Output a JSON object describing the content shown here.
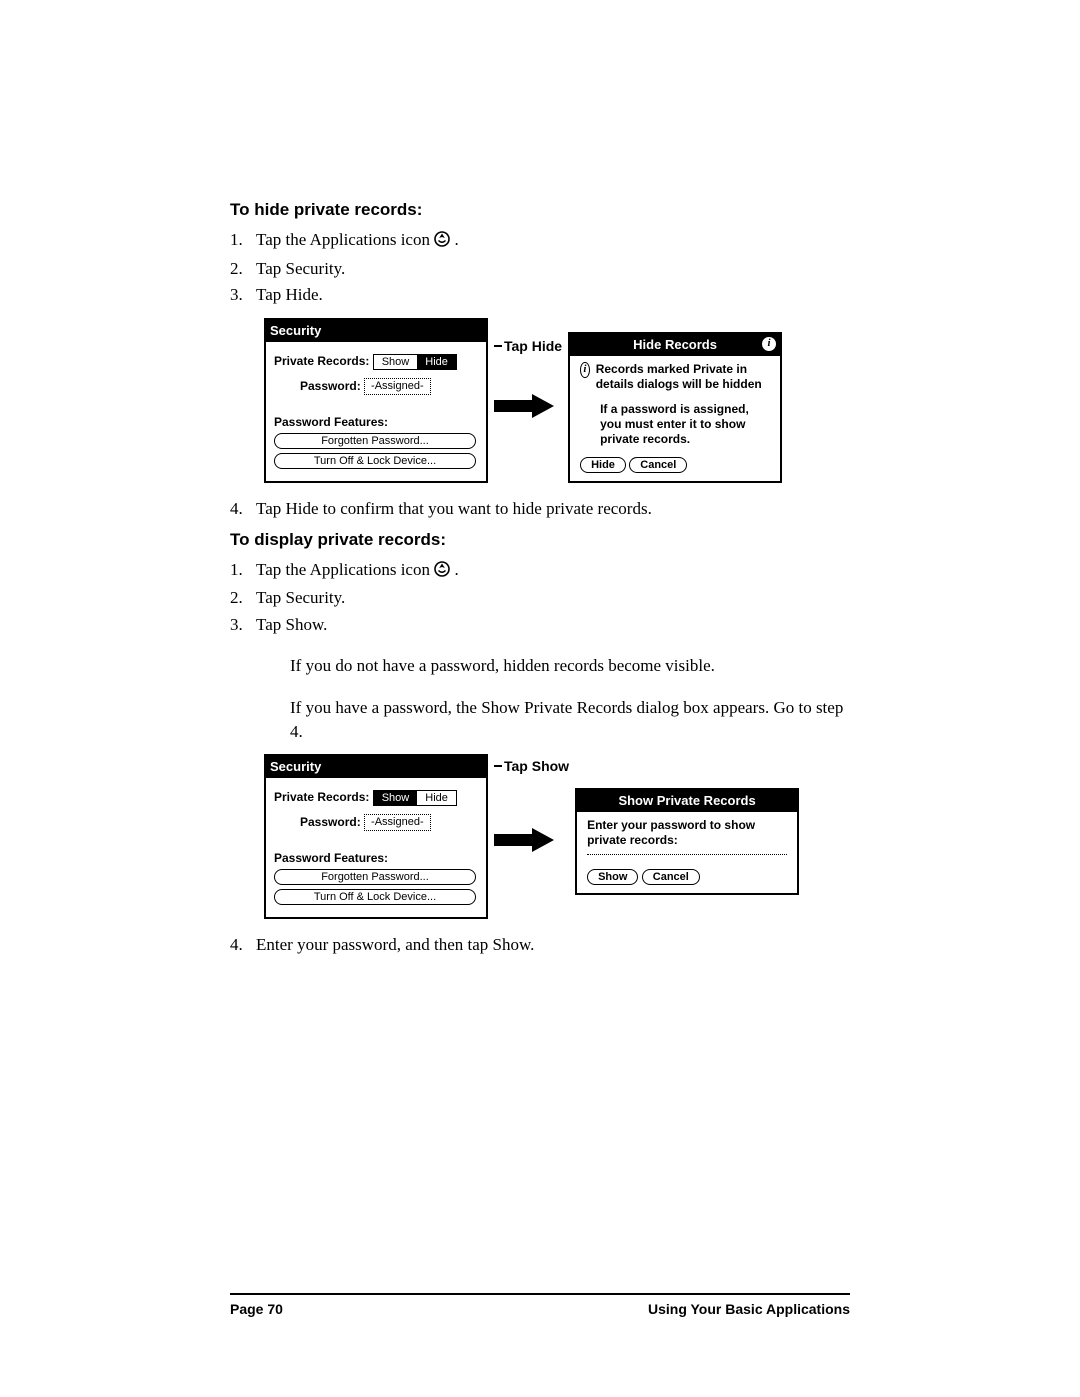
{
  "section1": {
    "heading": "To hide private records:",
    "steps": [
      {
        "n": "1.",
        "t_before": "Tap the Applications icon ",
        "t_after": " ."
      },
      {
        "n": "2.",
        "t": "Tap Security."
      },
      {
        "n": "3.",
        "t": "Tap Hide."
      }
    ],
    "after_step": {
      "n": "4.",
      "t": "Tap Hide to confirm that you want to hide private records."
    }
  },
  "section2": {
    "heading": "To display private records:",
    "steps": [
      {
        "n": "1.",
        "t_before": "Tap the Applications icon ",
        "t_after": " ."
      },
      {
        "n": "2.",
        "t": "Tap Security."
      },
      {
        "n": "3.",
        "t": "Tap Show."
      }
    ],
    "notes": [
      "If you do not have a password, hidden records become visible.",
      "If you have a password, the Show Private Records dialog box appears. Go to step 4."
    ],
    "after_step": {
      "n": "4.",
      "t": "Enter your password, and then tap Show."
    }
  },
  "security_panel": {
    "title": "Security",
    "priv_lbl": "Private Records:",
    "show": "Show",
    "hide": "Hide",
    "password_lbl": "Password:",
    "password_val": "-Assigned-",
    "features_lbl": "Password Features:",
    "btn_forgot": "Forgotten Password...",
    "btn_lock": "Turn Off & Lock Device..."
  },
  "callouts": {
    "tap_hide": "Tap Hide",
    "tap_show": "Tap Show"
  },
  "hide_dialog": {
    "title": "Hide Records",
    "line1": "Records marked Private in details dialogs will be hidden",
    "line2": "If a password is assigned, you must enter it to show private records.",
    "btn_hide": "Hide",
    "btn_cancel": "Cancel"
  },
  "show_dialog": {
    "title": "Show Private Records",
    "line": "Enter your password to show private records:",
    "btn_show": "Show",
    "btn_cancel": "Cancel"
  },
  "footer": {
    "left": "Page 70",
    "right": "Using Your Basic Applications"
  }
}
